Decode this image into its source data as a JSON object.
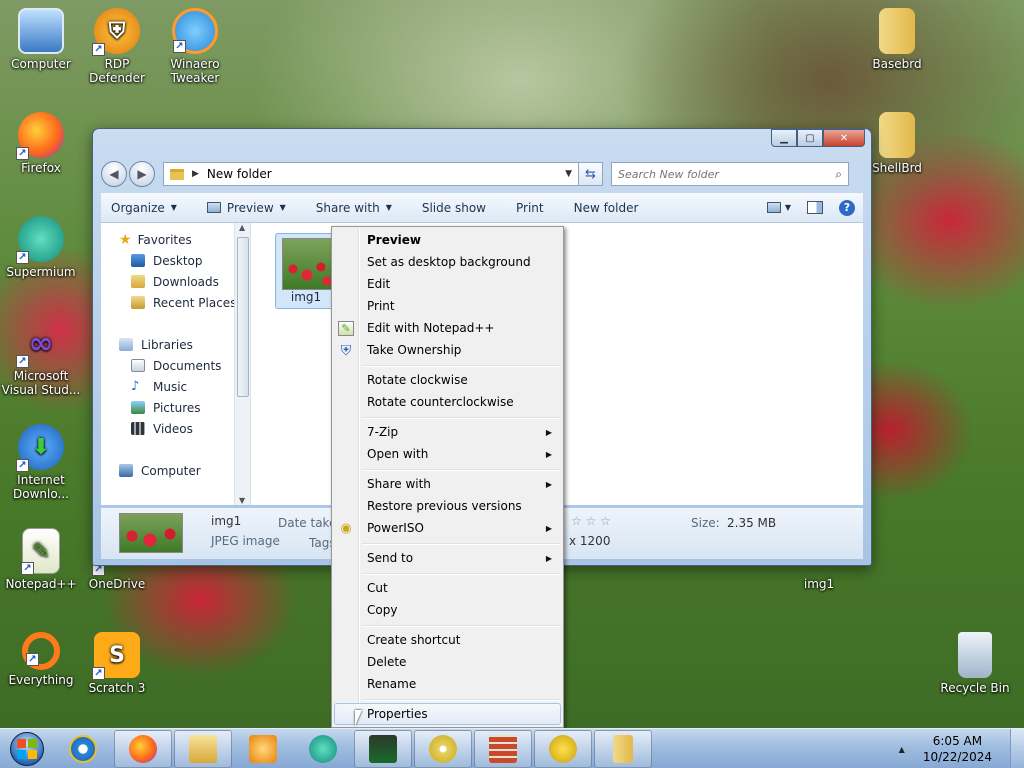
{
  "desktop": {
    "icons": [
      {
        "label": "Computer",
        "icon": "computer-icon"
      },
      {
        "label": "RDP Defender",
        "icon": "rdp-defender-icon"
      },
      {
        "label": "Winaero Tweaker",
        "icon": "winaero-tweaker-icon"
      },
      {
        "label": "Basebrd",
        "icon": "folder-icon"
      },
      {
        "label": "Firefox",
        "icon": "firefox-icon"
      },
      {
        "label": "ShellBrd",
        "icon": "folder-icon"
      },
      {
        "label": "Supermium",
        "icon": "supermium-icon"
      },
      {
        "label": "Microsoft Visual Stud...",
        "icon": "visual-studio-icon"
      },
      {
        "label": "Internet Downlo...",
        "icon": "internet-download-icon"
      },
      {
        "label": "Notepad++",
        "icon": "notepadpp-icon"
      },
      {
        "label": "OneDrive",
        "icon": "onedrive-icon"
      },
      {
        "label": "img1",
        "icon": "image-icon"
      },
      {
        "label": "Everything",
        "icon": "everything-icon"
      },
      {
        "label": "Scratch 3",
        "icon": "scratch-icon"
      },
      {
        "label": "Recycle Bin",
        "icon": "recycle-bin-icon"
      }
    ]
  },
  "explorer": {
    "address": "New folder",
    "search_placeholder": "Search New folder",
    "toolbar": {
      "organize": "Organize",
      "preview": "Preview",
      "share_with": "Share with",
      "slide_show": "Slide show",
      "print": "Print",
      "new_folder": "New folder"
    },
    "nav": {
      "favorites": "Favorites",
      "desktop": "Desktop",
      "downloads": "Downloads",
      "recent_places": "Recent Places",
      "libraries": "Libraries",
      "documents": "Documents",
      "music": "Music",
      "pictures": "Pictures",
      "videos": "Videos",
      "computer": "Computer"
    },
    "file": {
      "name": "img1"
    },
    "details": {
      "name": "img1",
      "type": "JPEG image",
      "date_taken_label": "Date taken:",
      "tags_label": "Tags:",
      "rating": "☆ ☆ ☆",
      "dimensions": "x 1200",
      "size_label": "Size:",
      "size_value": "2.35 MB"
    }
  },
  "context_menu": {
    "items": [
      {
        "label": "Preview",
        "bold": true
      },
      {
        "label": "Set as desktop background"
      },
      {
        "label": "Edit"
      },
      {
        "label": "Print"
      },
      {
        "label": "Edit with Notepad++"
      },
      {
        "label": "Take Ownership"
      },
      {
        "label": "Rotate clockwise"
      },
      {
        "label": "Rotate counterclockwise"
      },
      {
        "label": "7-Zip"
      },
      {
        "label": "Open with"
      },
      {
        "label": "Share with"
      },
      {
        "label": "Restore previous versions"
      },
      {
        "label": "PowerISO"
      },
      {
        "label": "Send to"
      },
      {
        "label": "Cut"
      },
      {
        "label": "Copy"
      },
      {
        "label": "Create shortcut"
      },
      {
        "label": "Delete"
      },
      {
        "label": "Rename"
      },
      {
        "label": "Properties"
      }
    ]
  },
  "taskbar": {
    "time": "6:05 AM",
    "date": "10/22/2024"
  }
}
